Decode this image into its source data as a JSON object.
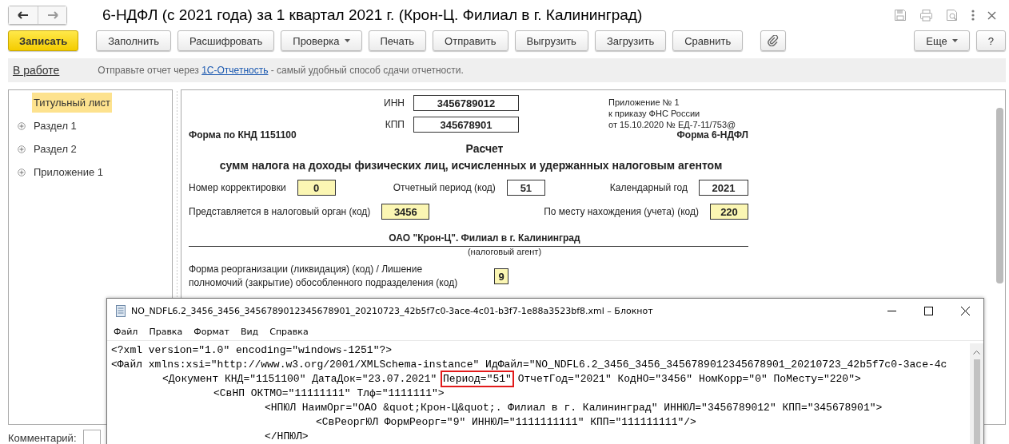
{
  "window": {
    "title": "6-НДФЛ (с 2021 года) за 1 квартал 2021 г. (Крон-Ц. Филиал в г. Калининград)"
  },
  "toolbar": {
    "buttons": [
      {
        "label": "Записать",
        "kind": "primary"
      },
      {
        "label": "Заполнить",
        "kind": "plain"
      },
      {
        "label": "Расшифровать",
        "kind": "plain"
      },
      {
        "label": "Проверка",
        "kind": "dropdown"
      },
      {
        "label": "Печать",
        "kind": "plain"
      },
      {
        "label": "Отправить",
        "kind": "plain"
      },
      {
        "label": "Выгрузить",
        "kind": "plain"
      },
      {
        "label": "Загрузить",
        "kind": "plain"
      },
      {
        "label": "Сравнить",
        "kind": "plain"
      },
      {
        "kind": "attach"
      }
    ],
    "right_buttons": [
      {
        "label": "Еще",
        "kind": "dropdown"
      },
      {
        "label": "?",
        "kind": "plain"
      }
    ]
  },
  "status": {
    "label": "В работе",
    "before": "Отправьте отчет через ",
    "link": "1С-Отчетность",
    "after": " - самый удобный способ сдачи отчетности."
  },
  "sidebar": {
    "items": [
      {
        "label": "Титульный лист",
        "selected": true,
        "expandable": false
      },
      {
        "label": "Раздел 1",
        "selected": false,
        "expandable": true
      },
      {
        "label": "Раздел 2",
        "selected": false,
        "expandable": true
      },
      {
        "label": "Приложение 1",
        "selected": false,
        "expandable": true
      }
    ]
  },
  "form": {
    "ids": [
      {
        "label": "ИНН",
        "value": "3456789012",
        "editable": false
      },
      {
        "label": "КПП",
        "value": "345678901",
        "editable": false
      }
    ],
    "note": [
      "Приложение № 1",
      "к приказу ФНС России",
      "от 15.10.2020 № ЕД-7-11/753@"
    ],
    "form_code": "Форма по КНД 1151100",
    "form_name": "Форма 6-НДФЛ",
    "title": "Расчет",
    "subtitle": "сумм налога на доходы физических лиц, исчисленных и удержанных налоговым агентом",
    "row_1": [
      {
        "label": "Номер корректировки",
        "value": "0",
        "editable": true
      },
      {
        "label": "Отчетный период (код)",
        "value": "51",
        "editable": false
      },
      {
        "label": "Календарный год",
        "value": "2021",
        "editable": false
      }
    ],
    "row_2": [
      {
        "label": "Представляется в налоговый орган (код)",
        "value": "3456",
        "editable": true
      },
      {
        "label": "По месту нахождения (учета) (код)",
        "value": "220",
        "editable": true
      }
    ],
    "agent_name": "ОАО \"Крон-Ц\". Филиал в г. Калининград",
    "agent_caption": "(налоговый агент)",
    "reorg": {
      "label": "Форма реорганизации (ликвидация) (код) / Лишение полномочий (закрытие) обособленного подразделения (код)",
      "value": "9",
      "editable": true
    }
  },
  "comment": {
    "label": "Комментарий:"
  },
  "notepad": {
    "title": "NO_NDFL6.2_3456_3456_3456789012345678901_20210723_42b5f7c0-3ace-4c01-b3f7-1e88a3523bf8.xml – Блокнот",
    "menu": [
      "Файл",
      "Правка",
      "Формат",
      "Вид",
      "Справка"
    ],
    "lines": [
      {
        "segments": [
          {
            "text": "<?xml version=\"1.0\" encoding=\"windows-1251\"?>",
            "highlighted": false
          }
        ]
      },
      {
        "segments": [
          {
            "text": "<Файл xmlns:xsi=\"http://www.w3.org/2001/XMLSchema-instance\" ИдФайл=\"NO_NDFL6.2_3456_3456_3456789012345678901_20210723_42b5f7c0-3ace-4c",
            "highlighted": false
          }
        ],
        "children": [
          {
            "segments": [
              {
                "text": "<Документ КНД=\"1151100\" ДатаДок=\"23.07.2021\" ",
                "highlighted": false
              },
              {
                "text": "Период=\"51\"",
                "highlighted": true
              },
              {
                "text": " ОтчетГод=\"2021\" КодНО=\"3456\" НомКорр=\"0\" ПоМесту=\"220\">",
                "highlighted": false
              }
            ],
            "children": [
              {
                "segments": [
                  {
                    "text": "<СвНП ОКТМО=\"11111111\" Тлф=\"1111111\">",
                    "highlighted": false
                  }
                ],
                "children": [
                  {
                    "segments": [
                      {
                        "text": "<НПЮЛ НаимОрг=\"ОАО &quot;Крон-Ц&quot;. Филиал в г. Калининград\" ИННЮЛ=\"3456789012\" КПП=\"345678901\">",
                        "highlighted": false
                      }
                    ],
                    "children": [
                      {
                        "segments": [
                          {
                            "text": "<СвРеоргЮЛ ФормРеорг=\"9\" ИННЮЛ=\"1111111111\" КПП=\"111111111\"/>",
                            "highlighted": false
                          }
                        ]
                      }
                    ]
                  },
                  {
                    "segments": [
                      {
                        "text": "</НПЮЛ>",
                        "highlighted": false
                      }
                    ]
                  }
                ]
              }
            ]
          }
        ]
      }
    ]
  }
}
